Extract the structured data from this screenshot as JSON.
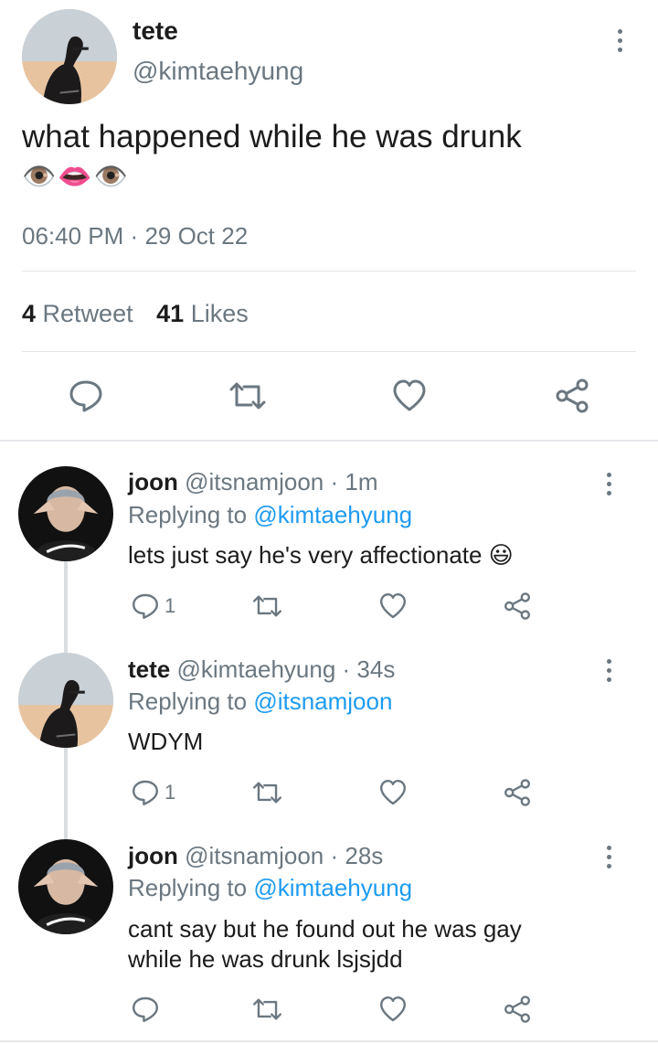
{
  "main_tweet": {
    "display_name": "tete",
    "handle": "@kimtaehyung",
    "text": "what happened while he was drunk",
    "emojis": "👁️👄👁️",
    "time": "06:40 PM",
    "separator": "·",
    "date": "29 Oct 22",
    "retweet_count": "4",
    "retweet_label": "Retweet",
    "likes_count": "41",
    "likes_label": "Likes"
  },
  "replies": [
    {
      "display_name": "joon",
      "handle": "@itsnamjoon",
      "age": "· 1m",
      "replying_label": "Replying to",
      "replying_to": "@kimtaehyung",
      "text": "lets just say he's very affectionate 😃",
      "reply_count": "1"
    },
    {
      "display_name": "tete",
      "handle": "@kimtaehyung",
      "age": "· 34s",
      "replying_label": "Replying to",
      "replying_to": "@itsnamjoon",
      "text": "WDYM",
      "reply_count": "1"
    },
    {
      "display_name": "joon",
      "handle": "@itsnamjoon",
      "age": "· 28s",
      "replying_label": "Replying to",
      "replying_to": "@kimtaehyung",
      "text_line1": "cant say but he found out he was gay",
      "text_line2": "while he was drunk lsjsjdd",
      "reply_count": ""
    }
  ],
  "icons": [
    "more-vertical-icon",
    "reply-icon",
    "retweet-icon",
    "heart-icon",
    "share-icon"
  ],
  "colors": {
    "link": "#1d9bf0",
    "muted": "#6b7780",
    "divider": "#e2e6e9"
  }
}
